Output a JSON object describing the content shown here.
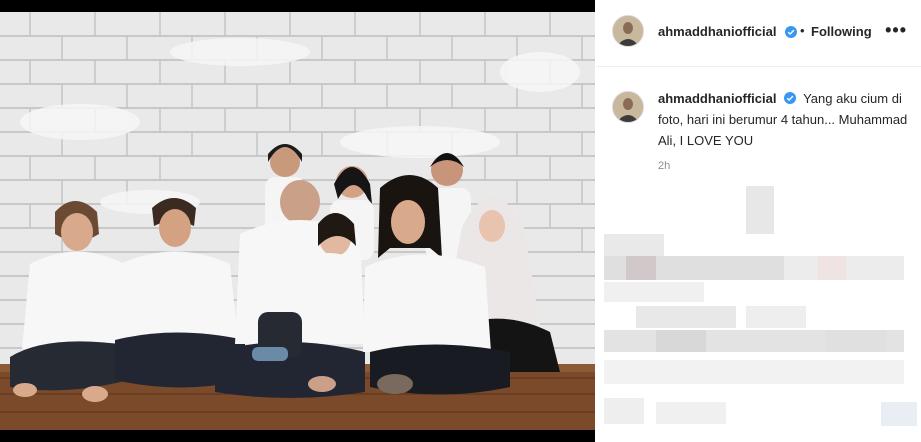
{
  "post": {
    "username": "ahmaddhaniofficial",
    "follow_status": "Following",
    "separator": "•",
    "more_icon": "more-horizontal-icon",
    "caption_text": "Yang aku cium di foto, hari ini berumur 4 tahun... Muhammad Ali, I LOVE YOU",
    "timestamp": "2h"
  },
  "colors": {
    "verified": "#3897f0",
    "muted": "#8e8e8e",
    "text": "#262626"
  }
}
